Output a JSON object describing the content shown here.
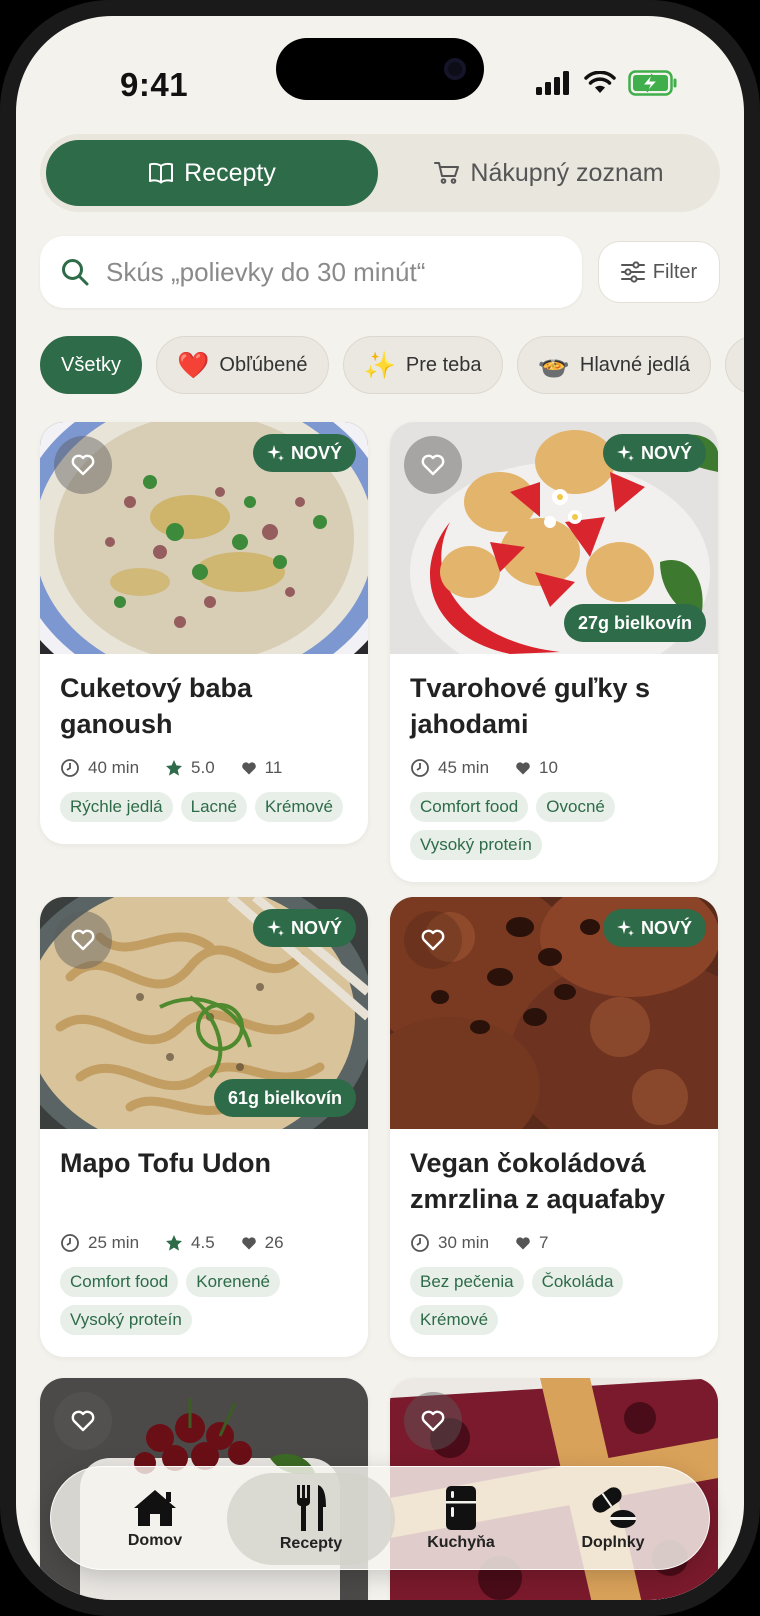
{
  "status": {
    "time": "9:41"
  },
  "segment": {
    "recipes_label": "Recepty",
    "shopping_label": "Nákupný zoznam"
  },
  "search": {
    "placeholder": "Skús „polievky do 30 minút“",
    "filter_label": "Filter"
  },
  "chips": [
    {
      "label": "Všetky",
      "emoji": ""
    },
    {
      "label": "Obľúbené",
      "emoji": "❤️"
    },
    {
      "label": "Pre teba",
      "emoji": "✨"
    },
    {
      "label": "Hlavné jedlá",
      "emoji": "🍲"
    }
  ],
  "badges": {
    "new": "NOVÝ"
  },
  "cards": [
    {
      "title": "Cuketový baba ganoush",
      "time": "40 min",
      "rating": "5.0",
      "likes": "11",
      "protein": "",
      "tags": [
        "Rýchle jedlá",
        "Lacné",
        "Krémové"
      ]
    },
    {
      "title": "Tvarohové guľky s jahodami",
      "time": "45 min",
      "rating": "",
      "likes": "10",
      "protein": "27g bielkovín",
      "tags": [
        "Comfort food",
        "Ovocné",
        "Vysoký proteín"
      ]
    },
    {
      "title": "Mapo Tofu Udon",
      "time": "25 min",
      "rating": "4.5",
      "likes": "26",
      "protein": "61g bielkovín",
      "tags": [
        "Comfort food",
        "Korenené",
        "Vysoký proteín"
      ]
    },
    {
      "title": "Vegan čokoládová zmrzlina z aquafaby",
      "time": "30 min",
      "rating": "",
      "likes": "7",
      "protein": "",
      "tags": [
        "Bez pečenia",
        "Čokoláda",
        "Krémové"
      ]
    }
  ],
  "tabbar": [
    {
      "label": "Domov",
      "icon": "house-icon"
    },
    {
      "label": "Recepty",
      "icon": "fork-knife-icon"
    },
    {
      "label": "Kuchyňa",
      "icon": "fridge-icon"
    },
    {
      "label": "Doplnky",
      "icon": "pill-icon"
    }
  ],
  "colors": {
    "accent": "#2e6b48",
    "background": "#f4f2ec",
    "tag_bg": "#e7efe8"
  }
}
